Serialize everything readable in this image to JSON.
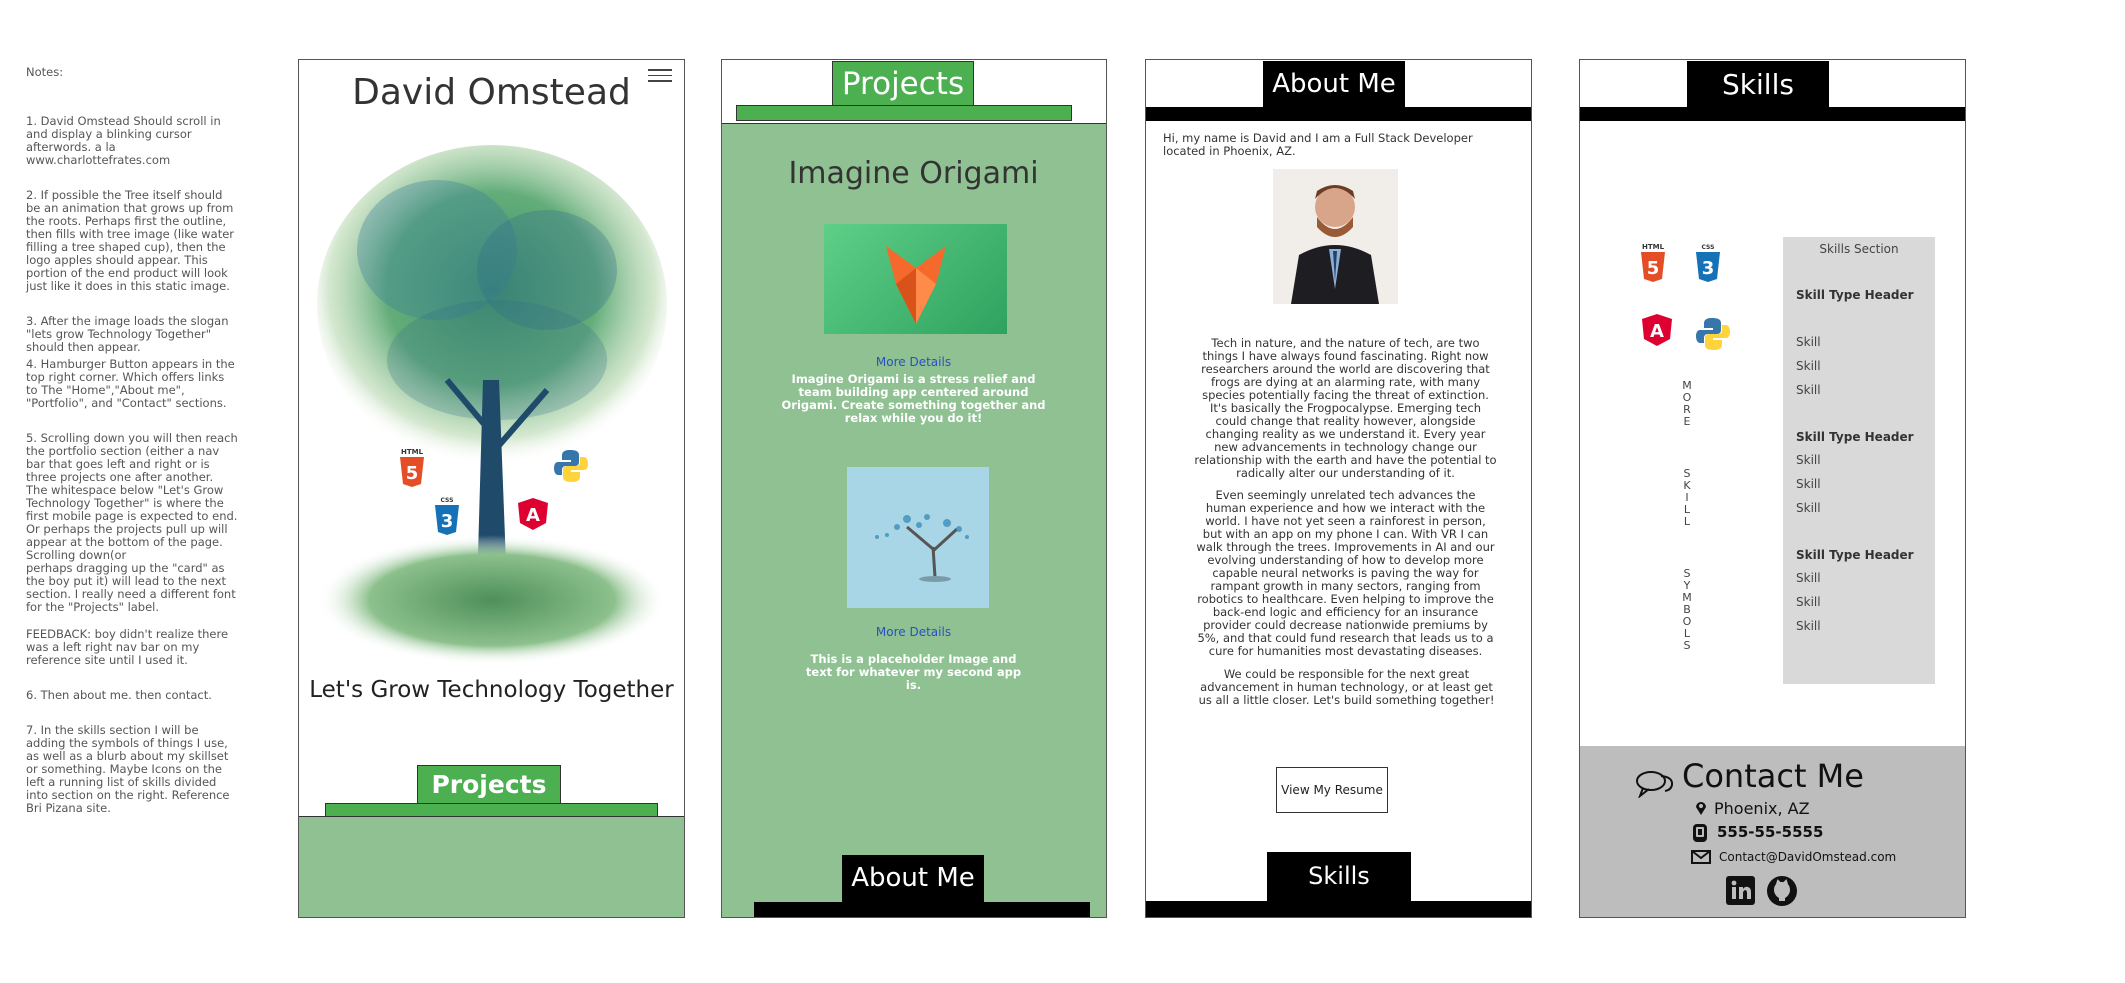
{
  "notes": {
    "header": "Notes:",
    "items": [
      "1. David Omstead Should scroll in and display a blinking cursor afterwords. a la  www.charlottefrates.com",
      "2. If possible the Tree itself should be an animation that grows up from the roots. Perhaps first the outline, then fills with tree image (like water filling a tree shaped cup), then the logo apples should appear. This portion of the end product will look just like it does in this static image.",
      "3. After the image loads the slogan \"lets grow Technology Together\" should then appear.",
      "4. Hamburger Button appears in the top right corner.  Which offers links to The \"Home\",\"About me\", \"Portfolio\", and \"Contact\" sections.",
      "5. Scrolling down you will then reach the portfolio section (either a nav bar that goes left and right or is three projects one after another.\nThe whitespace below \"Let's Grow Technology Together\" is where the first mobile page is expected to end. Or perhaps the projects pull up will appear at the bottom of the page. Scrolling down(or\nperhaps dragging up the \"card\" as the boy put it) will lead to the next section. I really need a different font for the \"Projects\" label.",
      "FEEDBACK:  boy didn't realize there was a left right nav bar on my reference site until I used it.",
      "6. Then about me. then contact.",
      "7. In the skills section I will be adding the symbols of things I use, as well as a blurb about my skillset or something. Maybe Icons on the left a running list of skills divided into section on the right. Reference Bri Pizana site."
    ]
  },
  "home": {
    "name": "David Omstead",
    "slogan": "Let's Grow Technology Together",
    "projects_tab": "Projects",
    "logos": {
      "html": "HTML",
      "css": "CSS"
    }
  },
  "projects": {
    "tab": "Projects",
    "title": "Imagine Origami",
    "more1": "More Details",
    "desc1": "Imagine Origami is a stress relief and team building app centered around Origami. Create something together and relax while you do it!",
    "more2": "More Details",
    "desc2": "This is a placeholder Image and text for whatever my second app is.",
    "about_tab": "About Me"
  },
  "about": {
    "tab": "About Me",
    "intro": "Hi, my name is David and I am a Full Stack Developer located in Phoenix, AZ.",
    "para1": "Tech in nature, and the nature of tech, are two things I have always found fascinating. Right now researchers around the world are discovering that frogs are dying at an alarming rate, with many species potentially facing the threat of extinction. It's basically the Frogpocalypse. Emerging tech could change that reality however, alongside changing reality as we understand it. Every year new advancements in technology change our relationship with the earth and have the potential to radically alter our understanding of it.",
    "para2": "Even seemingly unrelated tech advances the human experience and how we interact with the world. I have not yet seen a rainforest in person, but with an app on my phone I can. With VR I can walk through the trees. Improvements in AI and our evolving understanding of how to develop more capable neural networks is paving the way for rampant growth in many sectors, ranging from robotics to healthcare. Even helping to improve the back-end logic and efficiency for an insurance provider could decrease nationwide premiums by 5%, and that could fund research that leads us to a cure for humanities most devastating diseases.",
    "para3": "We could be responsible for the next great advancement in human technology, or at least get us all a little closer. Let's build something together!",
    "resume_btn": "View My Resume",
    "skills_tab": "Skills"
  },
  "skills": {
    "tab": "Skills",
    "section_title": "Skills Section",
    "vertical_words": [
      "MORE",
      "SKILL",
      "SYMBOLS"
    ],
    "groups": [
      {
        "header": "Skill Type Header",
        "items": [
          "Skill",
          "Skill",
          "Skill"
        ]
      },
      {
        "header": "Skill Type Header",
        "items": [
          "Skill",
          "Skill",
          "Skill"
        ]
      },
      {
        "header": "Skill Type Header",
        "items": [
          "Skill",
          "Skill",
          "Skill"
        ]
      }
    ],
    "logos": {
      "html": "HTML",
      "css": "CSS"
    }
  },
  "contact": {
    "title": "Contact Me",
    "location": "Phoenix, AZ",
    "phone": "555-55-5555",
    "email": "Contact@DavidOmstead.com"
  },
  "colors": {
    "green": "#4caf50",
    "pale_green": "#8fc192",
    "contact_gray": "#bdbdbd",
    "skills_gray": "#d9d9d9"
  }
}
